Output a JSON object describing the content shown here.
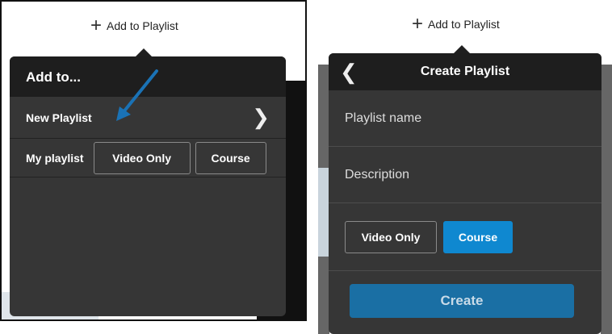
{
  "left": {
    "add_to_playlist": "Add to Playlist",
    "panel_title": "Add to...",
    "new_playlist": "New Playlist",
    "my_playlist": "My playlist",
    "video_only": "Video Only",
    "course": "Course",
    "icons": {
      "add": "plus-icon",
      "forward": "chevron-right-icon",
      "annotation": "arrow-icon"
    },
    "annotation_color": "#1a72b5"
  },
  "right": {
    "add_to_playlist": "Add to Playlist",
    "panel_title": "Create Playlist",
    "playlist_name_placeholder": "Playlist name",
    "description_placeholder": "Description",
    "video_only": "Video Only",
    "course": "Course",
    "create": "Create",
    "selected_type": "Course",
    "icons": {
      "add": "plus-icon",
      "back": "chevron-left-icon"
    },
    "accent_color": "#0f88d0"
  }
}
